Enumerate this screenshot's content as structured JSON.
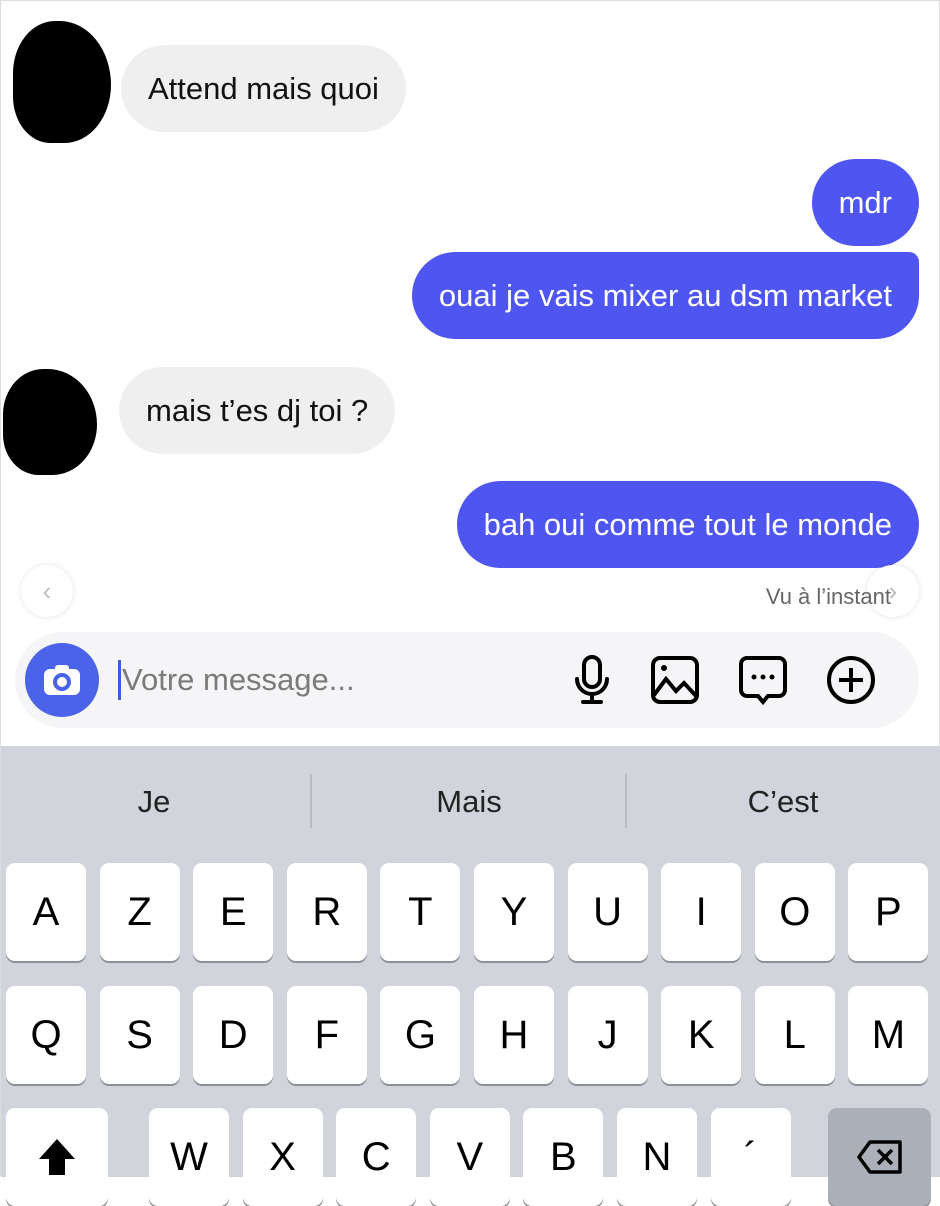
{
  "messages": [
    {
      "side": "received",
      "text": "Attend mais quoi"
    },
    {
      "side": "sent",
      "text": "mdr"
    },
    {
      "side": "sent",
      "text": "ouai je vais mixer au dsm market"
    },
    {
      "side": "received",
      "text": "mais t’es dj toi ?"
    },
    {
      "side": "sent",
      "text": "bah oui comme tout le monde"
    }
  ],
  "seen_status": "Vu à l’instant",
  "composer": {
    "placeholder": "Votre message..."
  },
  "suggestions": [
    "Je",
    "Mais",
    "C’est"
  ],
  "keyboard": {
    "row1": [
      "A",
      "Z",
      "E",
      "R",
      "T",
      "Y",
      "U",
      "I",
      "O",
      "P"
    ],
    "row2": [
      "Q",
      "S",
      "D",
      "F",
      "G",
      "H",
      "J",
      "K",
      "L",
      "M"
    ],
    "row3": [
      "W",
      "X",
      "C",
      "V",
      "B",
      "N",
      "´"
    ]
  },
  "colors": {
    "sent_bubble": "#4f55f0",
    "received_bubble": "#efefef",
    "camera_button": "#4a63e8",
    "keyboard_bg": "#d1d4da"
  }
}
